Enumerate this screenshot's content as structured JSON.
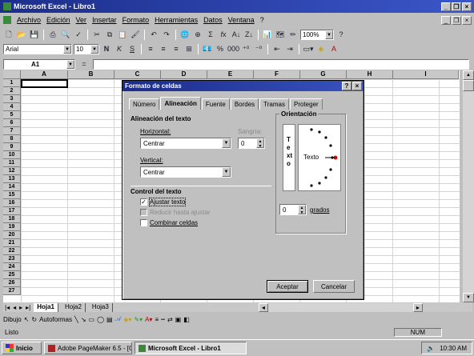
{
  "window": {
    "title": "Microsoft Excel - Libro1"
  },
  "menu": [
    "Archivo",
    "Edición",
    "Ver",
    "Insertar",
    "Formato",
    "Herramientas",
    "Datos",
    "Ventana",
    "?"
  ],
  "toolbar": {
    "zoom": "100%",
    "font": "Arial",
    "font_size": "10"
  },
  "formula_bar": {
    "cell_ref": "A1"
  },
  "grid": {
    "columns": [
      "A",
      "B",
      "C",
      "D",
      "E",
      "F",
      "G",
      "H",
      "I"
    ],
    "rows": [
      "1",
      "2",
      "3",
      "4",
      "5",
      "6",
      "7",
      "8",
      "9",
      "10",
      "11",
      "12",
      "13",
      "14",
      "15",
      "16",
      "17",
      "18",
      "19",
      "20",
      "21",
      "22",
      "23",
      "24",
      "25",
      "26",
      "27"
    ]
  },
  "sheets": {
    "tabs": [
      "Hoja1",
      "Hoja2",
      "Hoja3"
    ],
    "active": "Hoja1"
  },
  "drawing": {
    "draw_label": "Dibujo",
    "autoshapes_label": "Autoformas"
  },
  "status": {
    "text": "Listo",
    "num": "NUM"
  },
  "taskbar": {
    "start": "Inicio",
    "items": [
      "Adobe PageMaker 6.5 - [C",
      "Microsoft Excel - Libro1"
    ],
    "time": "10:30 AM"
  },
  "dialog": {
    "title": "Formato de celdas",
    "tabs": [
      "Número",
      "Alineación",
      "Fuente",
      "Bordes",
      "Tramas",
      "Proteger"
    ],
    "active_tab": "Alineación",
    "text_alignment_label": "Alineación del texto",
    "horizontal_label": "Horizontal:",
    "horizontal_value": "Centrar",
    "indent_label": "Sangría:",
    "indent_value": "0",
    "vertical_label": "Vertical:",
    "vertical_value": "Centrar",
    "text_control_label": "Control del texto",
    "wrap_text": {
      "label": "Ajustar texto",
      "checked": true
    },
    "shrink_to_fit": {
      "label": "Reducir hasta ajustar",
      "checked": false,
      "disabled": true
    },
    "merge_cells": {
      "label": "Combinar celdas",
      "checked": false
    },
    "orientation_label": "Orientación",
    "vertical_text": "Texto",
    "dial_text": "Texto",
    "degrees_value": "0",
    "degrees_label": "grados",
    "ok_label": "Aceptar",
    "cancel_label": "Cancelar"
  }
}
